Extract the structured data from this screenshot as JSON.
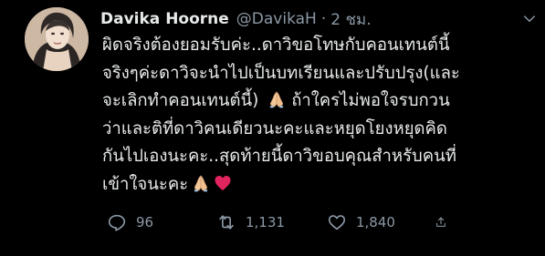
{
  "user": {
    "display_name": "Davika Hoorne",
    "handle": "@DavikaH",
    "time": "2 ชม."
  },
  "tweet": {
    "lines": [
      "ผิดจริงต้องยอมรับค่ะ..ดาวิขอโทษกับคอนเทนต์นี้",
      "จริงๆค่ะดาวิจะนำไปเป็นบทเรียนและปรับปรุง(และ",
      "จะเลิกทำคอนเทนต์นี้)",
      "ถ้าใครไม่พอใจรบกวน",
      "ว่าและติที่ดาวิคนเดียวนะคะและหยุดโยงหยุดคิด",
      "กันไปเองนะคะ..สุดท้ายนี้ดาวิขอบคุณสำหรับคนที่",
      "เข้าใจนะคะ"
    ],
    "emojis": [
      "folded-hands",
      "folded-hands",
      "red-heart"
    ]
  },
  "actions": {
    "replies": "96",
    "retweets": "1,131",
    "likes": "1,840"
  },
  "colors": {
    "background": "#000000",
    "text": "#e7e9ea",
    "muted": "#8b98a5",
    "heart": "#e0245e"
  }
}
